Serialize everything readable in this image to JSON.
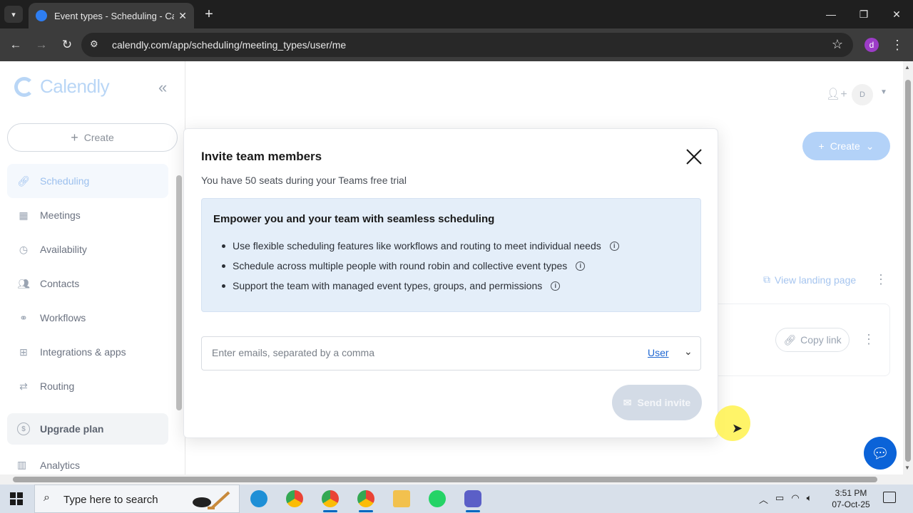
{
  "browser": {
    "tab_title": "Event types - Scheduling - Calendly",
    "url": "calendly.com/app/scheduling/meeting_types/user/me",
    "profile_initial": "d"
  },
  "sidebar": {
    "logo_text": "Calendly",
    "create_label": "Create",
    "items": [
      {
        "label": "Scheduling",
        "icon": "link-icon"
      },
      {
        "label": "Meetings",
        "icon": "calendar-icon"
      },
      {
        "label": "Availability",
        "icon": "clock-icon"
      },
      {
        "label": "Contacts",
        "icon": "contacts-icon"
      },
      {
        "label": "Workflows",
        "icon": "workflows-icon"
      },
      {
        "label": "Integrations & apps",
        "icon": "grid-icon"
      },
      {
        "label": "Routing",
        "icon": "routing-icon"
      }
    ],
    "upgrade_label": "Upgrade plan",
    "analytics_label": "Analytics"
  },
  "header": {
    "avatar_initial": "D",
    "create_label": "Create"
  },
  "main": {
    "view_landing_label": "View landing page",
    "copy_link_label": "Copy link"
  },
  "modal": {
    "title": "Invite team members",
    "subtitle": "You have 50 seats during your Teams free trial",
    "promo_title": "Empower you and your team with seamless scheduling",
    "promo_items": [
      "Use flexible scheduling features like workflows and routing to meet individual needs",
      "Schedule across multiple people with round robin and collective event types",
      "Support the team with managed event types, groups, and permissions"
    ],
    "email_placeholder": "Enter emails, separated by a comma",
    "role_value": "User",
    "send_label": "Send invite"
  },
  "taskbar": {
    "search_placeholder": "Type here to search",
    "time": "3:51 PM",
    "date": "07-Oct-25"
  },
  "colors": {
    "brand_blue": "#0b63d8",
    "link_blue": "#1f67d2",
    "promo_bg": "#e4eef9"
  }
}
